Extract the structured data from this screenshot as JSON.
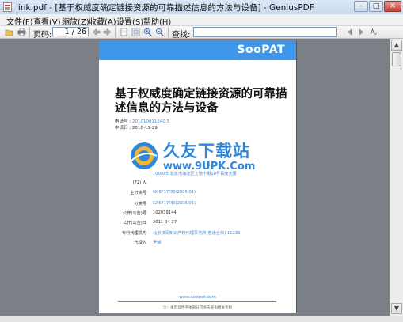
{
  "window": {
    "title": "link.pdf - [基于权威度确定链接资源的可靠描述信息的方法与设备] - GeniusPDF",
    "controls": {
      "minimize": "–",
      "maximize": "□",
      "close": "✕"
    }
  },
  "menu": [
    {
      "label": "文件(F)"
    },
    {
      "label": "查看(V)"
    },
    {
      "label": "缩放(Z)"
    },
    {
      "label": "收藏(A)"
    },
    {
      "label": "设置(S)"
    },
    {
      "label": "帮助(H)"
    }
  ],
  "toolbar": {
    "page_label": "页码:",
    "page_value": "1 / 26",
    "search_label": "查找:",
    "search_value": "",
    "icons": [
      "open-folder-icon",
      "print-icon",
      "back-arrow-icon",
      "forward-arrow-icon",
      "single-page-icon",
      "fit-page-icon",
      "zoom-in-icon",
      "zoom-out-icon",
      "search-prev-icon",
      "search-next-icon",
      "search-options-icon"
    ]
  },
  "document": {
    "brand": "SooPAT",
    "title": "基于权威度确定链接资源的可靠描述信息的方法与设备",
    "meta": [
      {
        "label": "申请号 :",
        "value": "201010011640.5"
      },
      {
        "label": "申请日 :",
        "value": "2010-11-29"
      }
    ],
    "rows": [
      {
        "label": "",
        "value": "100085 北京市海淀区上地十街10号百度大厦",
        "dark": false
      },
      {
        "label": "(72) 人",
        "value": "",
        "dark": false
      },
      {
        "label": "主分类号",
        "value": "G06F17/30(2006.01)I",
        "dark": false
      },
      {
        "label": "分类号",
        "value": "G06F17/30(2006.01)I",
        "dark": false
      },
      {
        "label": "公开(公告)号",
        "value": "102039144",
        "dark": true
      },
      {
        "label": "公开(公告)日",
        "value": "2011-04-27",
        "dark": true
      },
      {
        "label": "专利代理机构",
        "value": "北京汉昊知识产权代理事务所(普通合伙) 11235",
        "dark": false
      },
      {
        "label": "代理人",
        "value": "罗朗",
        "dark": false
      }
    ],
    "footer_site": "www.soopat.com",
    "footer_note": "注：本页蓝色字体部分可点击查询相关专利"
  },
  "watermark": {
    "title": "久友下载站",
    "url": "www.9UPK.Com"
  },
  "colors": {
    "brand_band": "#3f97ea",
    "watermark": "#2f86d8",
    "viewer_bg": "#7b7f86"
  }
}
